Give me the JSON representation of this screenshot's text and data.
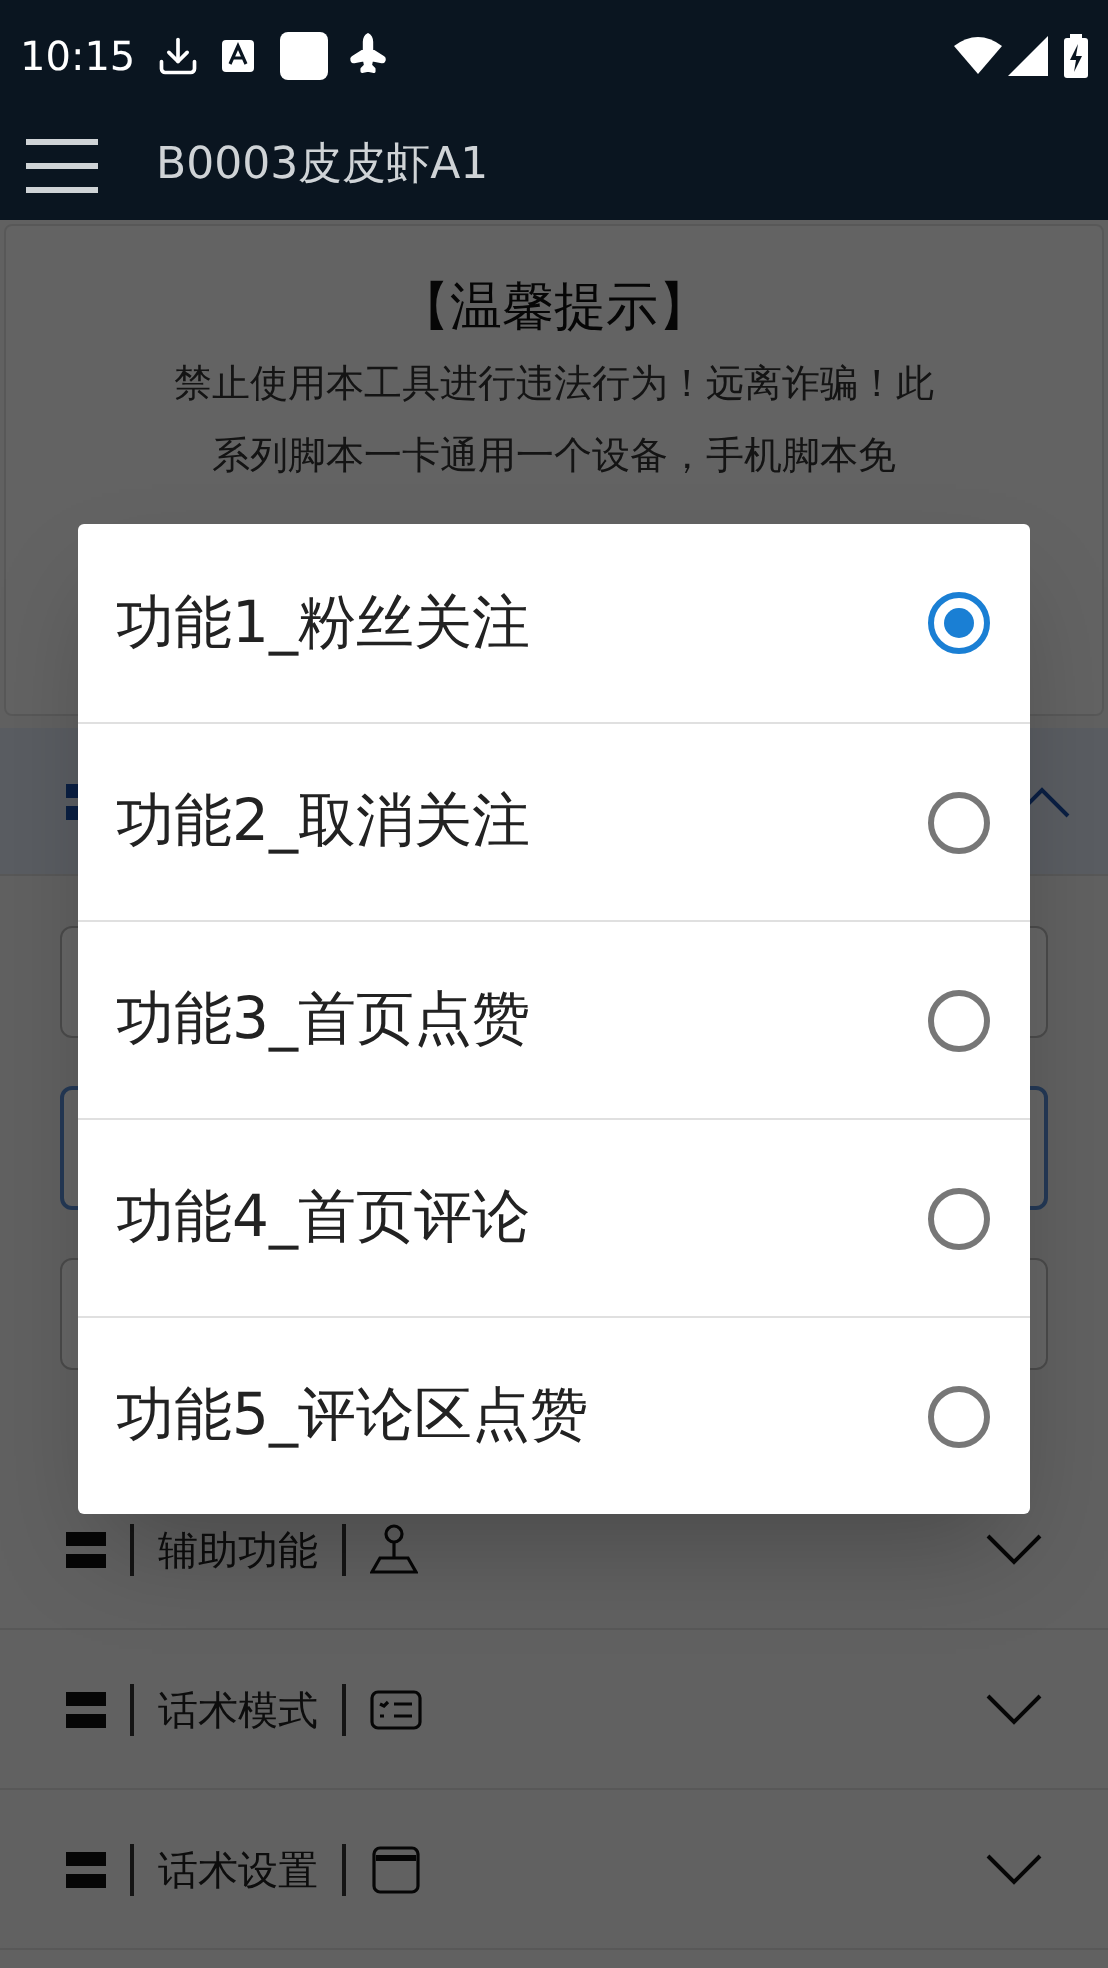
{
  "status_bar": {
    "time": "10:15"
  },
  "app_bar": {
    "title": "B0003皮皮虾A1"
  },
  "notice": {
    "title": "【温馨提示】",
    "lines": [
      "禁止使用本工具进行违法行为！远离诈骗！此",
      "系列脚本一卡通用一个设备，手机脚本免"
    ]
  },
  "sections": [
    {
      "expanded": true
    },
    {
      "label": "辅助功能",
      "kind": "assist",
      "expanded": false
    },
    {
      "label": "话术模式",
      "kind": "list",
      "expanded": false
    },
    {
      "label": "话术设置",
      "kind": "calendar",
      "expanded": false
    }
  ],
  "dialog": {
    "options": [
      {
        "label": "功能1_粉丝关注",
        "selected": true
      },
      {
        "label": "功能2_取消关注",
        "selected": false
      },
      {
        "label": "功能3_首页点赞",
        "selected": false
      },
      {
        "label": "功能4_首页评论",
        "selected": false
      },
      {
        "label": "功能5_评论区点赞",
        "selected": false
      }
    ]
  }
}
